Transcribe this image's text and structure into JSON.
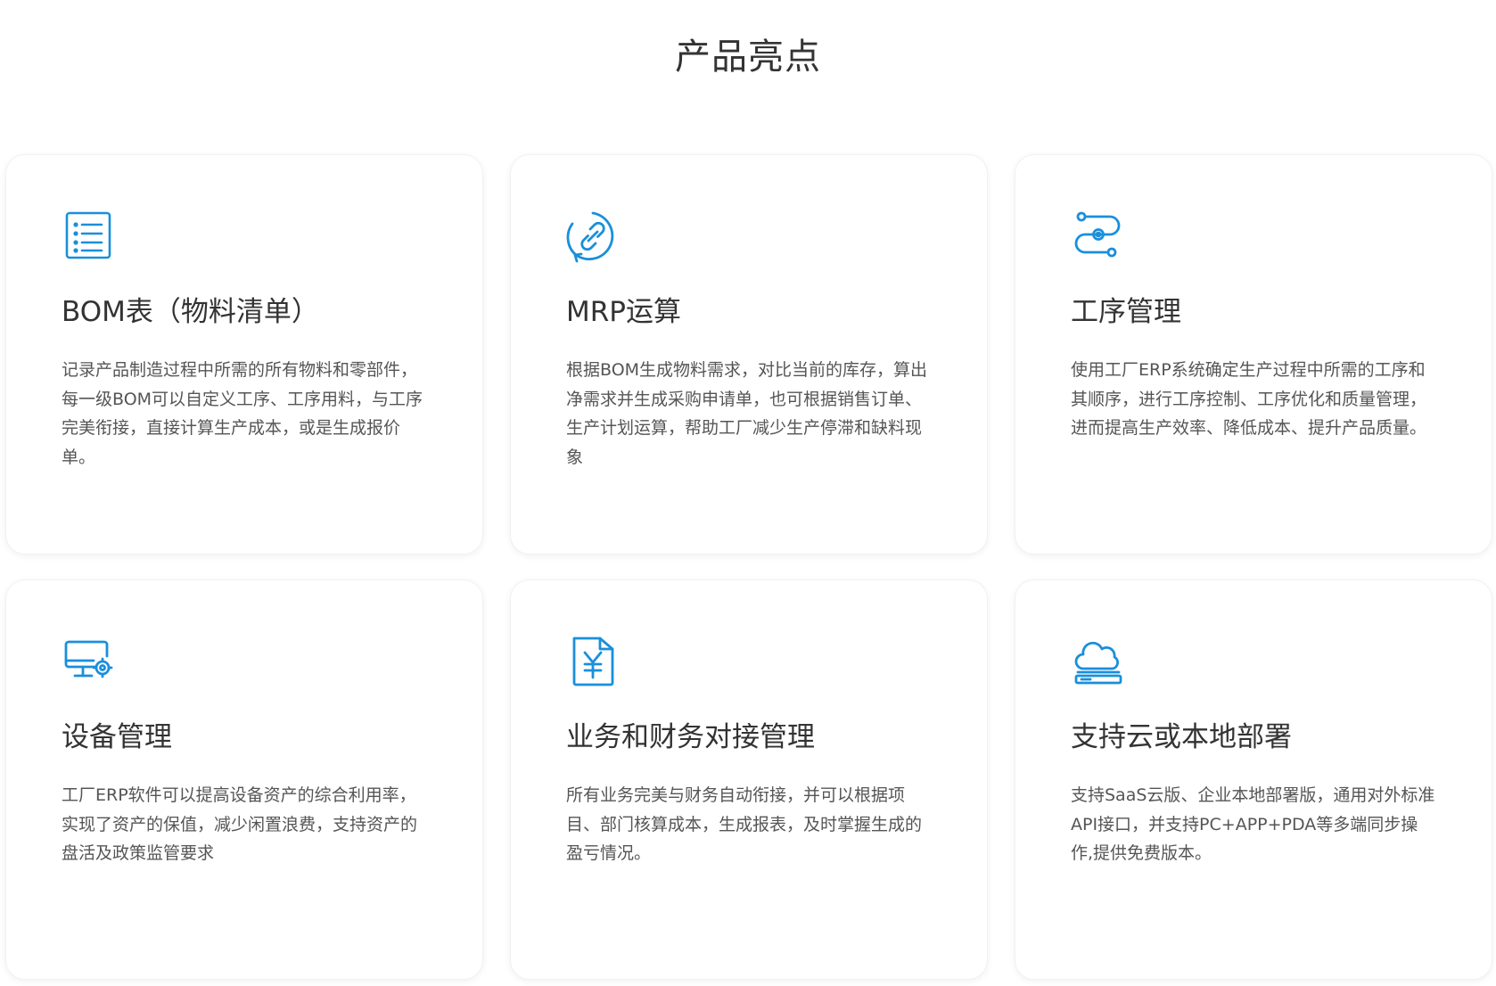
{
  "section": {
    "title": "产品亮点"
  },
  "accent_color": "#1a8fdb",
  "cards": [
    {
      "icon": "list-icon",
      "title": "BOM表（物料清单）",
      "description": "记录产品制造过程中所需的所有物料和零部件，每一级BOM可以自定义工序、工序用料，与工序完美衔接，直接计算生产成本，或是生成报价单。"
    },
    {
      "icon": "link-icon",
      "title": "MRP运算",
      "description": "根据BOM生成物料需求，对比当前的库存，算出净需求并生成采购申请单，也可根据销售订单、生产计划运算，帮助工厂减少生产停滞和缺料现象"
    },
    {
      "icon": "process-flow-icon",
      "title": "工序管理",
      "description": "使用工厂ERP系统确定生产过程中所需的工序和其顺序，进行工序控制、工序优化和质量管理，进而提高生产效率、降低成本、提升产品质量。"
    },
    {
      "icon": "monitor-settings-icon",
      "title": "设备管理",
      "description": "工厂ERP软件可以提高设备资产的综合利用率，实现了资产的保值，减少闲置浪费，支持资产的盘活及政策监管要求"
    },
    {
      "icon": "finance-document-icon",
      "title": "业务和财务对接管理",
      "description": "所有业务完美与财务自动衔接，并可以根据项目、部门核算成本，生成报表，及时掌握生成的盈亏情况。"
    },
    {
      "icon": "cloud-server-icon",
      "title": "支持云或本地部署",
      "description": "支持SaaS云版、企业本地部署版，通用对外标准API接口，并支持PC+APP+PDA等多端同步操作,提供免费版本。"
    }
  ]
}
